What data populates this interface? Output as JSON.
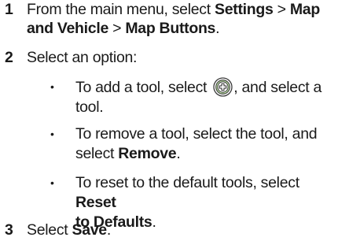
{
  "steps": [
    {
      "number": "1",
      "parts": [
        "From the main menu, select ",
        "Settings",
        " > ",
        "Map",
        "and Vehicle",
        " > ",
        "Map Buttons",
        "."
      ]
    },
    {
      "number": "2",
      "text": "Select an option:"
    },
    {
      "number": "3",
      "parts": [
        "Select ",
        "Save",
        "."
      ]
    }
  ],
  "options": [
    {
      "bullet": "•",
      "parts": [
        "To add a tool, select ",
        ", and select a",
        "tool."
      ],
      "icon": "plus-circle-icon"
    },
    {
      "bullet": "•",
      "parts": [
        "To remove a tool, select the tool, and",
        "select ",
        "Remove",
        "."
      ]
    },
    {
      "bullet": "•",
      "parts": [
        "To reset to the default tools, select ",
        "Reset",
        "to Defaults",
        "."
      ]
    }
  ]
}
